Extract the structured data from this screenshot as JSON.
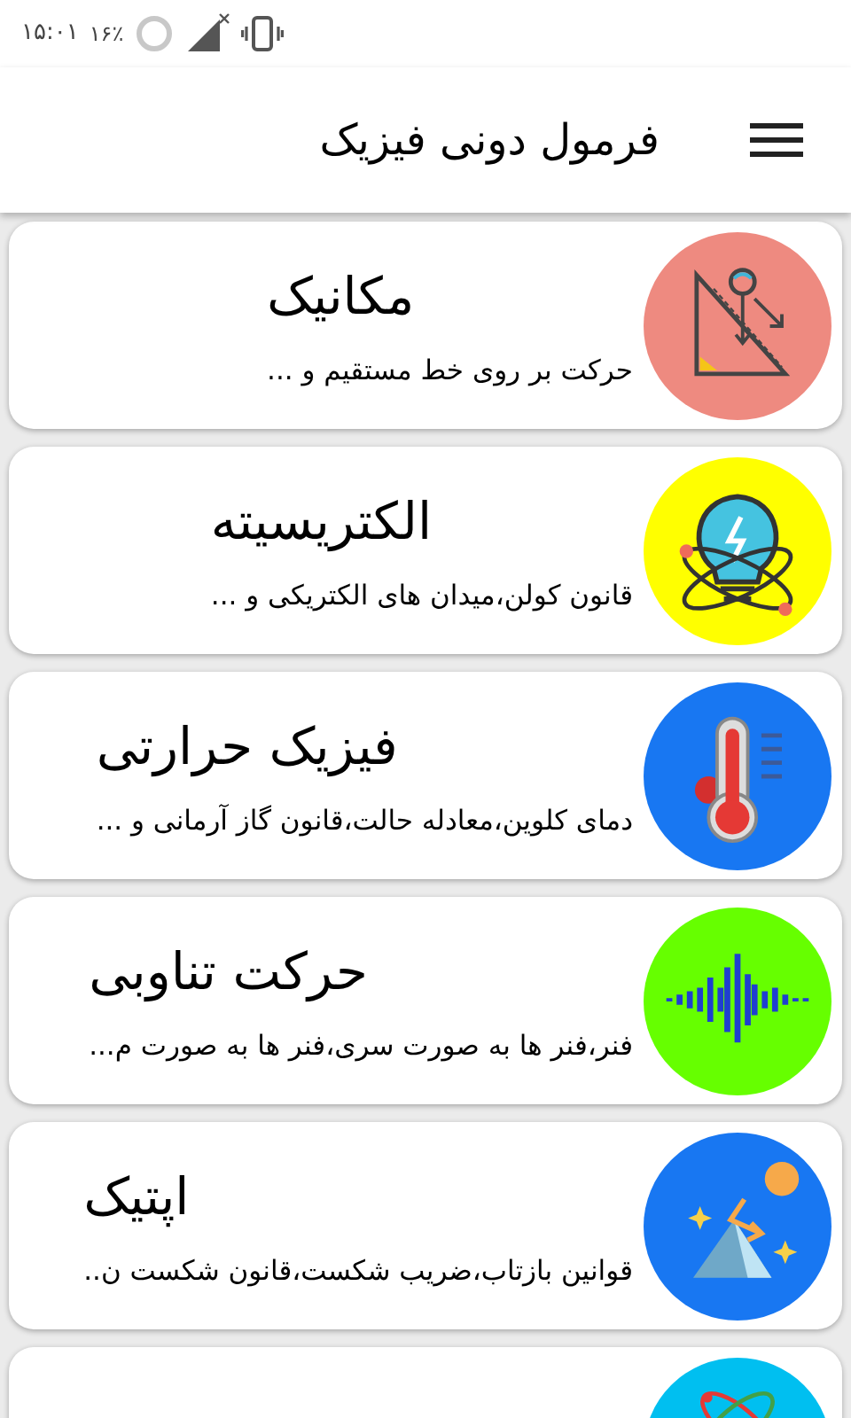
{
  "status_bar": {
    "time": "۱۵:۰۱",
    "battery": "۱۶٪"
  },
  "app_bar": {
    "title": "فرمول دونی فیزیک"
  },
  "topics": [
    {
      "kind": "mechanics",
      "title": "مکانیک",
      "subtitle": "حرکت بر روی خط مستقیم و ...",
      "color": "#ee8a80"
    },
    {
      "kind": "electricity",
      "title": "الکتریسیته",
      "subtitle": "قانون کولن،میدان های الکتریکی و ...",
      "color": "#ffff00"
    },
    {
      "kind": "thermal",
      "title": "فیزیک حرارتی",
      "subtitle": "دمای کلوین،معادله حالت،قانون گاز آرمانی و ...",
      "color": "#1877f2"
    },
    {
      "kind": "oscillation",
      "title": "حرکت تناوبی",
      "subtitle": "فنر،فنر ها به صورت سری،فنر ها به صورت م...",
      "color": "#66ff00"
    },
    {
      "kind": "optics",
      "title": "اپتیک",
      "subtitle": "قوانین بازتاب،ضریب شکست،قانون شکست ن..",
      "color": "#1877f2"
    },
    {
      "kind": "atom",
      "color": "#00bff0"
    }
  ]
}
